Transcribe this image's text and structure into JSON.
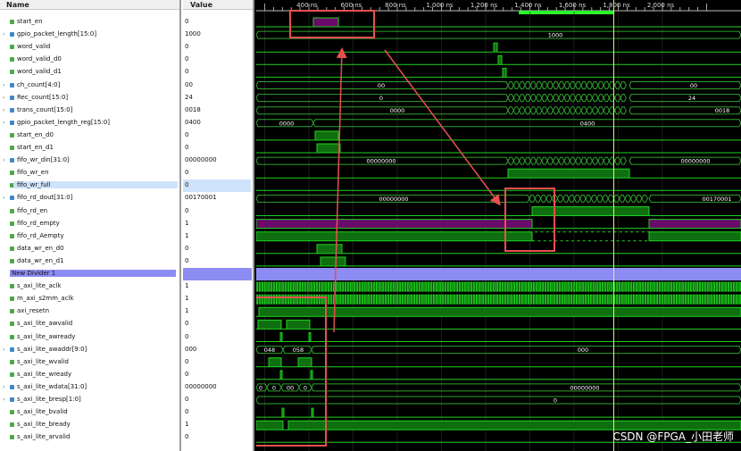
{
  "columns": {
    "name": "Name",
    "value": "Value"
  },
  "timeline": {
    "ticks": [
      "400 ns",
      "600 ns",
      "800 ns",
      "1,000 ns",
      "1,200 ns",
      "1,400 ns",
      "1,600 ns",
      "1,800 ns",
      "2,000 ns"
    ],
    "cursor_label": "1,80"
  },
  "signals": [
    {
      "name": "start_en",
      "value": "0",
      "type": "bit",
      "expand": false
    },
    {
      "name": "gpio_packet_length[15:0]",
      "value": "1000",
      "type": "bus",
      "expand": true
    },
    {
      "name": "word_valid",
      "value": "0",
      "type": "bit",
      "expand": false
    },
    {
      "name": "word_valid_d0",
      "value": "0",
      "type": "bit",
      "expand": false
    },
    {
      "name": "word_valid_d1",
      "value": "0",
      "type": "bit",
      "expand": false
    },
    {
      "name": "ch_count[4:0]",
      "value": "00",
      "type": "bus",
      "expand": true
    },
    {
      "name": "Rec_count[15:0]",
      "value": "24",
      "type": "bus",
      "expand": true
    },
    {
      "name": "trans_count[15:0]",
      "value": "0018",
      "type": "bus",
      "expand": true
    },
    {
      "name": "gpio_packet_length_reg[15:0]",
      "value": "0400",
      "type": "bus",
      "expand": true
    },
    {
      "name": "start_en_d0",
      "value": "0",
      "type": "bit",
      "expand": false
    },
    {
      "name": "start_en_d1",
      "value": "0",
      "type": "bit",
      "expand": false
    },
    {
      "name": "fifo_wr_din[31:0]",
      "value": "00000000",
      "type": "bus",
      "expand": true
    },
    {
      "name": "fifo_wr_en",
      "value": "0",
      "type": "bit",
      "expand": false
    },
    {
      "name": "fifo_wr_full",
      "value": "0",
      "type": "bit",
      "expand": false,
      "highlight": true
    },
    {
      "name": "fifo_rd_dout[31:0]",
      "value": "00170001",
      "type": "bus",
      "expand": true
    },
    {
      "name": "fifo_rd_en",
      "value": "0",
      "type": "bit",
      "expand": false
    },
    {
      "name": "fifo_rd_empty",
      "value": "1",
      "type": "bit",
      "expand": false
    },
    {
      "name": "fifo_rd_Aempty",
      "value": "1",
      "type": "bit",
      "expand": false
    },
    {
      "name": "data_wr_en_d0",
      "value": "0",
      "type": "bit",
      "expand": false
    },
    {
      "name": "data_wr_en_d1",
      "value": "0",
      "type": "bit",
      "expand": false
    },
    {
      "name": "New Divider 1",
      "value": "",
      "type": "divider",
      "expand": false
    },
    {
      "name": "s_axi_lite_aclk",
      "value": "1",
      "type": "bit",
      "expand": false
    },
    {
      "name": "m_axi_s2mm_aclk",
      "value": "1",
      "type": "bit",
      "expand": false
    },
    {
      "name": "axi_resetn",
      "value": "1",
      "type": "bit",
      "expand": false
    },
    {
      "name": "s_axi_lite_awvalid",
      "value": "0",
      "type": "bit",
      "expand": false
    },
    {
      "name": "s_axi_lite_awready",
      "value": "0",
      "type": "bit",
      "expand": false
    },
    {
      "name": "s_axi_lite_awaddr[9:0]",
      "value": "000",
      "type": "bus",
      "expand": true
    },
    {
      "name": "s_axi_lite_wvalid",
      "value": "0",
      "type": "bit",
      "expand": false
    },
    {
      "name": "s_axi_lite_wready",
      "value": "0",
      "type": "bit",
      "expand": false
    },
    {
      "name": "s_axi_lite_wdata[31:0]",
      "value": "00000000",
      "type": "bus",
      "expand": true
    },
    {
      "name": "s_axi_lite_bresp[1:0]",
      "value": "0",
      "type": "bus",
      "expand": true
    },
    {
      "name": "s_axi_lite_bvalid",
      "value": "0",
      "type": "bit",
      "expand": false
    },
    {
      "name": "s_axi_lite_bready",
      "value": "1",
      "type": "bit",
      "expand": false
    },
    {
      "name": "s_axi_lite_arvalid",
      "value": "0",
      "type": "bit",
      "expand": false
    }
  ],
  "bus_labels": {
    "gpio_packet_length": "1000",
    "ch_count_a": "00",
    "ch_count_b": "00",
    "rec_count_a": "0",
    "rec_count_b": "24",
    "trans_count_a": "0000",
    "trans_count_b": "0018",
    "gpio_len_reg_a": "0000",
    "gpio_len_reg_b": "0400",
    "fifo_wr_din_a": "00000000",
    "fifo_wr_din_b": "00000000",
    "fifo_rd_dout_a": "00000000",
    "fifo_rd_dout_b": "00170001",
    "awaddr_a": "048",
    "awaddr_b": "058",
    "awaddr_c": "000",
    "wdata_a": "0",
    "wdata_b": "0",
    "wdata_c": "00",
    "wdata_d": "0",
    "wdata_e": "00000000",
    "bresp": "0"
  },
  "watermark": "CSDN @FPGA_小田老师",
  "colors": {
    "wave": "#1fd21f",
    "bus": "#2ea32e",
    "fill_green": "#0f6e10",
    "fill_purple": "#6a0a6a",
    "divider": "#8c8cf2",
    "cursor": "#f0f060",
    "annot": "#e85050",
    "marker": "#2aff2a"
  }
}
